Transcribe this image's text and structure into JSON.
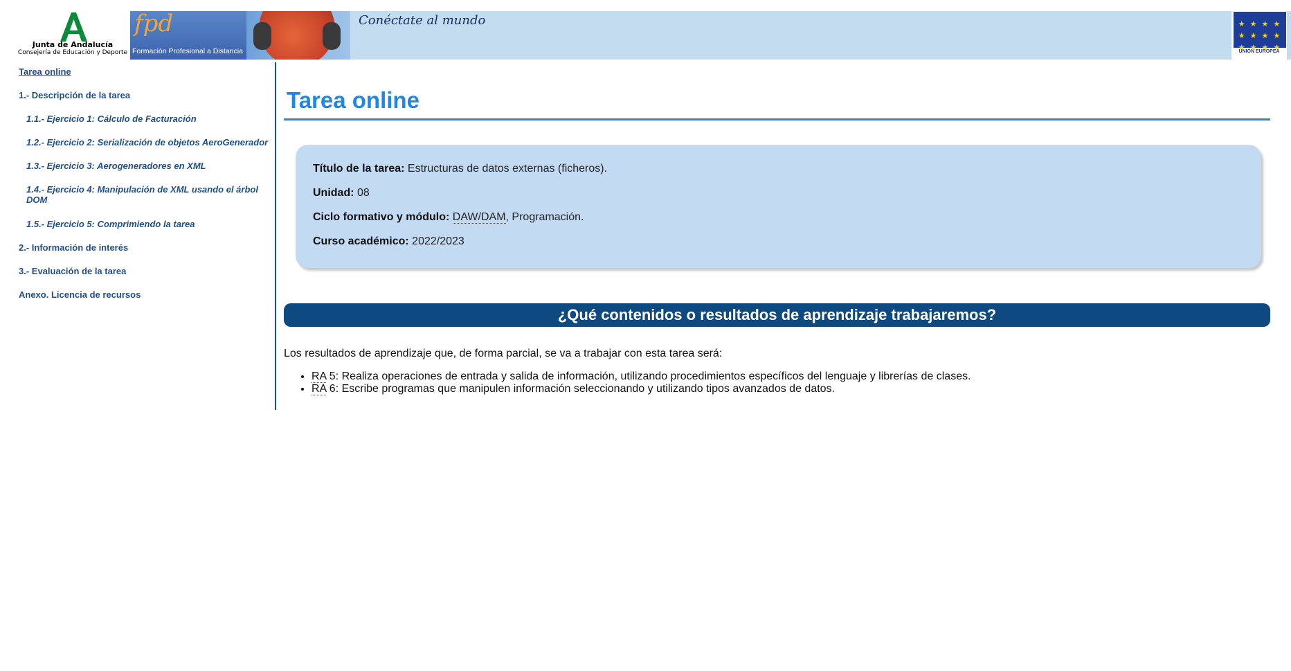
{
  "banner": {
    "org_name": "Junta de Andalucía",
    "org_sub": "Consejería de Educación y Deporte",
    "fpd_logo": "fpd",
    "fpd_label": "Formación Profesional a Distancia",
    "slogan": "Conéctate al mundo",
    "eu_label": "UNIÓN EUROPEA",
    "eu_stars": "★ ★ ★ ★ ★ ★ ★ ★ ★ ★ ★ ★"
  },
  "sidebar": {
    "items": [
      {
        "label": "Tarea online"
      },
      {
        "label": "1.- Descripción de la tarea"
      },
      {
        "label": "1.1.- Ejercicio 1: Cálculo de Facturación"
      },
      {
        "label": "1.2.- Ejercicio 2: Serialización de objetos AeroGenerador"
      },
      {
        "label": "1.3.- Ejercicio 3: Aerogeneradores en XML"
      },
      {
        "label": "1.4.- Ejercicio 4: Manipulación de XML usando el árbol DOM"
      },
      {
        "label": "1.5.- Ejercicio 5: Comprimiendo la tarea"
      },
      {
        "label": "2.- Información de interés"
      },
      {
        "label": "3.- Evaluación de la tarea"
      },
      {
        "label": "Anexo. Licencia de recursos"
      }
    ]
  },
  "main": {
    "title": "Tarea online",
    "info": {
      "titulo_label": "Título de la tarea:",
      "titulo_value": " Estructuras de datos externas (ficheros).",
      "unidad_label": "Unidad:",
      "unidad_value": " 08",
      "ciclo_label": "Ciclo formativo y módulo:",
      "ciclo_abbr": "DAW/DAM",
      "ciclo_value": ", Programación.",
      "curso_label": "Curso académico:",
      "curso_value": " 2022/2023"
    },
    "section_heading": "¿Qué contenidos o resultados de aprendizaje trabajaremos?",
    "intro": "Los resultados de aprendizaje que, de forma parcial, se va a trabajar con esta tarea será:",
    "ra": [
      {
        "abbr": "RA",
        "text": " 5: Realiza operaciones de entrada y salida de información, utilizando procedimientos específicos del lenguaje y librerías de clases."
      },
      {
        "abbr": "RA",
        "text": " 6: Escribe programas que manipulen información seleccionando y utilizando tipos avanzados de datos."
      }
    ]
  },
  "colors": {
    "accent": "#1e88e5",
    "nav": "#1f4e8c",
    "info_box": "#c3daf3",
    "section_bar": "#0e4a80",
    "junta_green": "#0b8a3a"
  }
}
